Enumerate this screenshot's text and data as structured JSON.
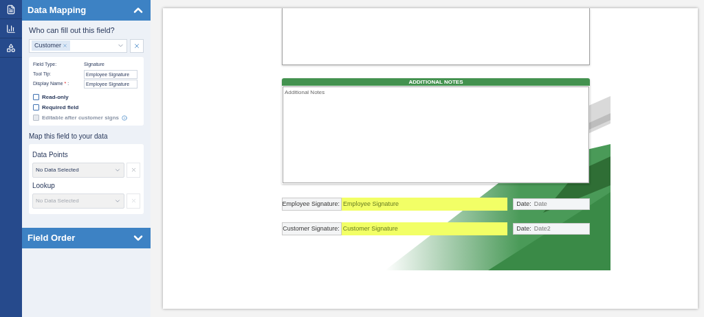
{
  "rail": {
    "items": [
      {
        "kind": "document",
        "selected": false
      },
      {
        "kind": "chart",
        "selected": false
      },
      {
        "kind": "shapes",
        "selected": false
      }
    ]
  },
  "data_mapping": {
    "title": "Data Mapping",
    "expanded": true,
    "question": "Who can fill out this field?",
    "tags": [
      "Customer"
    ],
    "properties": [
      {
        "label": "Field Type:",
        "kind": "text",
        "value": "Signature",
        "required": false
      },
      {
        "label": "Tool Tip:",
        "kind": "input",
        "value": "Employee Signature",
        "required": false
      },
      {
        "label": "Display Name",
        "kind": "input",
        "value": "Employee Signature",
        "required": true
      }
    ],
    "required_mark": "*",
    "label_suffix": ":",
    "options": [
      {
        "label": "Read-only",
        "checked": false,
        "disabled": false,
        "info": false
      },
      {
        "label": "Required field",
        "checked": false,
        "disabled": false,
        "info": false
      },
      {
        "label": "Editable after customer signs",
        "checked": false,
        "disabled": true,
        "info": true
      }
    ],
    "map_title": "Map this field to your data",
    "selects": [
      {
        "label": "Data Points",
        "value": "No Data Selected",
        "disabled": false
      },
      {
        "label": "Lookup",
        "value": "No Data Selected",
        "disabled": true
      }
    ]
  },
  "field_order": {
    "title": "Field Order",
    "expanded": false
  },
  "document": {
    "notes_header": "ADDITIONAL NOTES",
    "notes_placeholder": "Additional Notes",
    "signatures": [
      {
        "label": "Employee Signature:",
        "value": "Employee Signature",
        "date_label": "Date:",
        "date_value": "Date"
      },
      {
        "label": "Customer Signature:",
        "value": "Customer Signature",
        "date_label": "Date:",
        "date_value": "Date2"
      }
    ]
  }
}
